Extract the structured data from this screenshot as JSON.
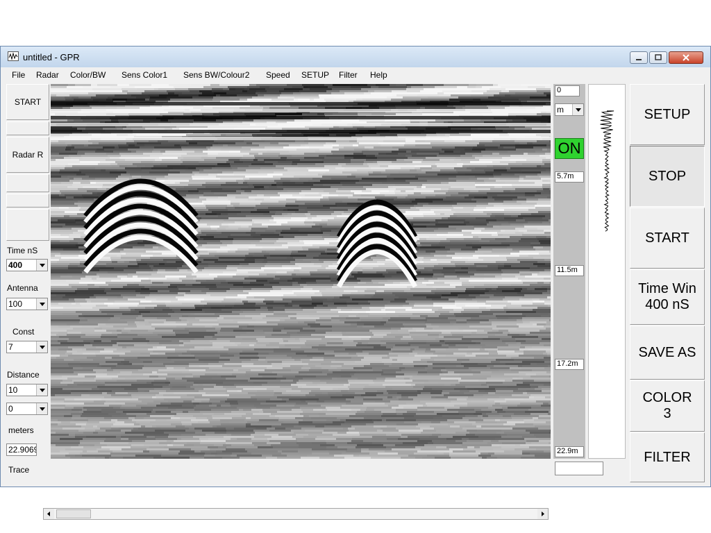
{
  "window": {
    "title": "untitled -  GPR"
  },
  "menu": [
    "File",
    "Radar",
    "Color/BW",
    "Sens Color1",
    "Sens BW/Colour2",
    "Speed",
    "SETUP",
    "Filter",
    "Help"
  ],
  "left": {
    "start_label": "START",
    "radar_label": "Radar R",
    "time_label": "Time nS",
    "time_value": "400",
    "antenna_label": "Antenna",
    "antenna_value": "100",
    "const_label": "Const",
    "const_value": "7",
    "distance_label": "Distance",
    "distance_value": "10",
    "distance_value2": "0",
    "meters_label": "meters",
    "meters_value": "22.9069",
    "trace_label": "Trace"
  },
  "depth": {
    "top_value": "0",
    "unit": "m",
    "status": "ON",
    "markers": [
      "5.7m",
      "11.5m",
      "17.2m",
      "22.9m"
    ]
  },
  "right": {
    "buttons": [
      {
        "label": "SETUP",
        "pressed": false
      },
      {
        "label": "STOP",
        "pressed": true
      },
      {
        "label": "START",
        "pressed": false
      },
      {
        "label": "Time Win",
        "label2": "400 nS",
        "pressed": false
      },
      {
        "label": "SAVE AS",
        "pressed": false
      },
      {
        "label": "COLOR",
        "label2": "3",
        "pressed": false
      },
      {
        "label": "FILTER",
        "pressed": false
      }
    ]
  },
  "colors": {
    "on_indicator": "#2fd22f",
    "window_frame": "#bcd3ea",
    "close_button": "#c9442a"
  },
  "icons": [
    "gpr-app-icon",
    "minimize-icon",
    "maximize-icon",
    "close-icon",
    "chevron-down-icon",
    "scroll-left-icon",
    "scroll-right-icon"
  ]
}
